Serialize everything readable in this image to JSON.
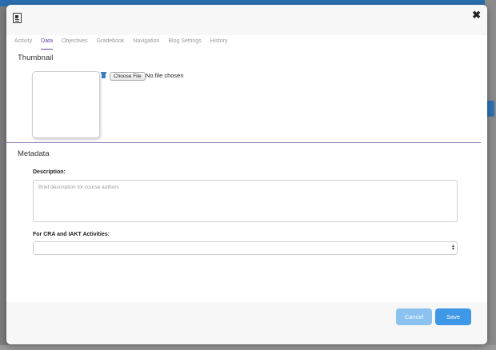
{
  "header": {
    "close_glyph": "✖"
  },
  "tabs": [
    {
      "label": "Activity",
      "active": false
    },
    {
      "label": "Data",
      "active": true
    },
    {
      "label": "Objectives",
      "active": false
    },
    {
      "label": "Gradebook",
      "active": false
    },
    {
      "label": "Navigation",
      "active": false
    },
    {
      "label": "Blog Settings",
      "active": false
    },
    {
      "label": "History",
      "active": false
    }
  ],
  "thumbnail": {
    "title": "Thumbnail",
    "choose_file_label": "Choose File",
    "file_status": "No file chosen"
  },
  "metadata": {
    "title": "Metadata",
    "description_label": "Description:",
    "description_placeholder": "Brief description for course authors",
    "cra_label": "For CRA and IAKT Activities:",
    "cra_selected": ""
  },
  "footer": {
    "cancel_label": "Cancel",
    "save_label": "Save"
  },
  "colors": {
    "accent": "#6b3fa0",
    "primary_button": "#3e98e6",
    "cancel_button": "#8cc2f0"
  }
}
